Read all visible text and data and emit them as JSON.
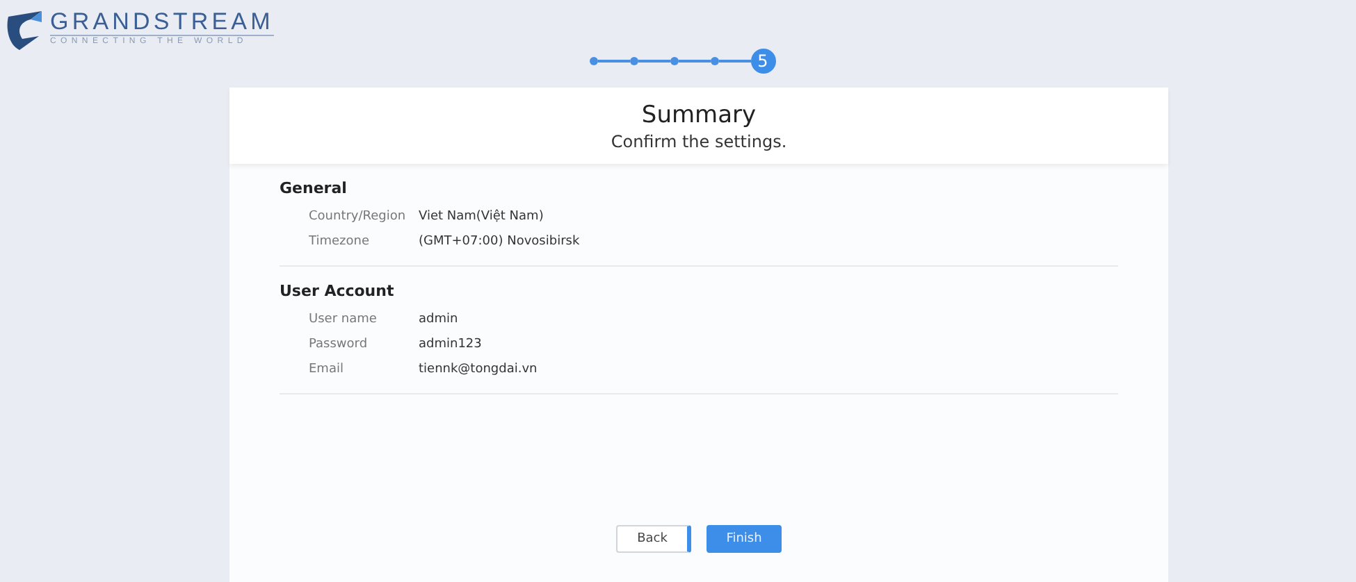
{
  "logo": {
    "name": "GRANDSTREAM",
    "tagline": "CONNECTING THE WORLD"
  },
  "steps": [
    {
      "selected": false
    },
    {
      "selected": false
    },
    {
      "selected": false
    },
    {
      "selected": false
    },
    {
      "selected": true,
      "label": "5"
    }
  ],
  "card": {
    "title": "Summary",
    "subtitle": "Confirm the settings."
  },
  "sections": [
    {
      "title": "General",
      "rows": [
        {
          "label": "Country/Region",
          "value": "Viet Nam(Việt Nam)"
        },
        {
          "label": "Timezone",
          "value": "(GMT+07:00) Novosibirsk"
        }
      ]
    },
    {
      "title": "User Account",
      "rows": [
        {
          "label": "User name",
          "value": "admin"
        },
        {
          "label": "Password",
          "value": "admin123"
        },
        {
          "label": "Email",
          "value": "tiennk@tongdai.vn"
        }
      ]
    }
  ],
  "buttons": [
    {
      "label": "Back",
      "kind": "secondary"
    },
    {
      "label": "Finish",
      "kind": "primary"
    }
  ]
}
